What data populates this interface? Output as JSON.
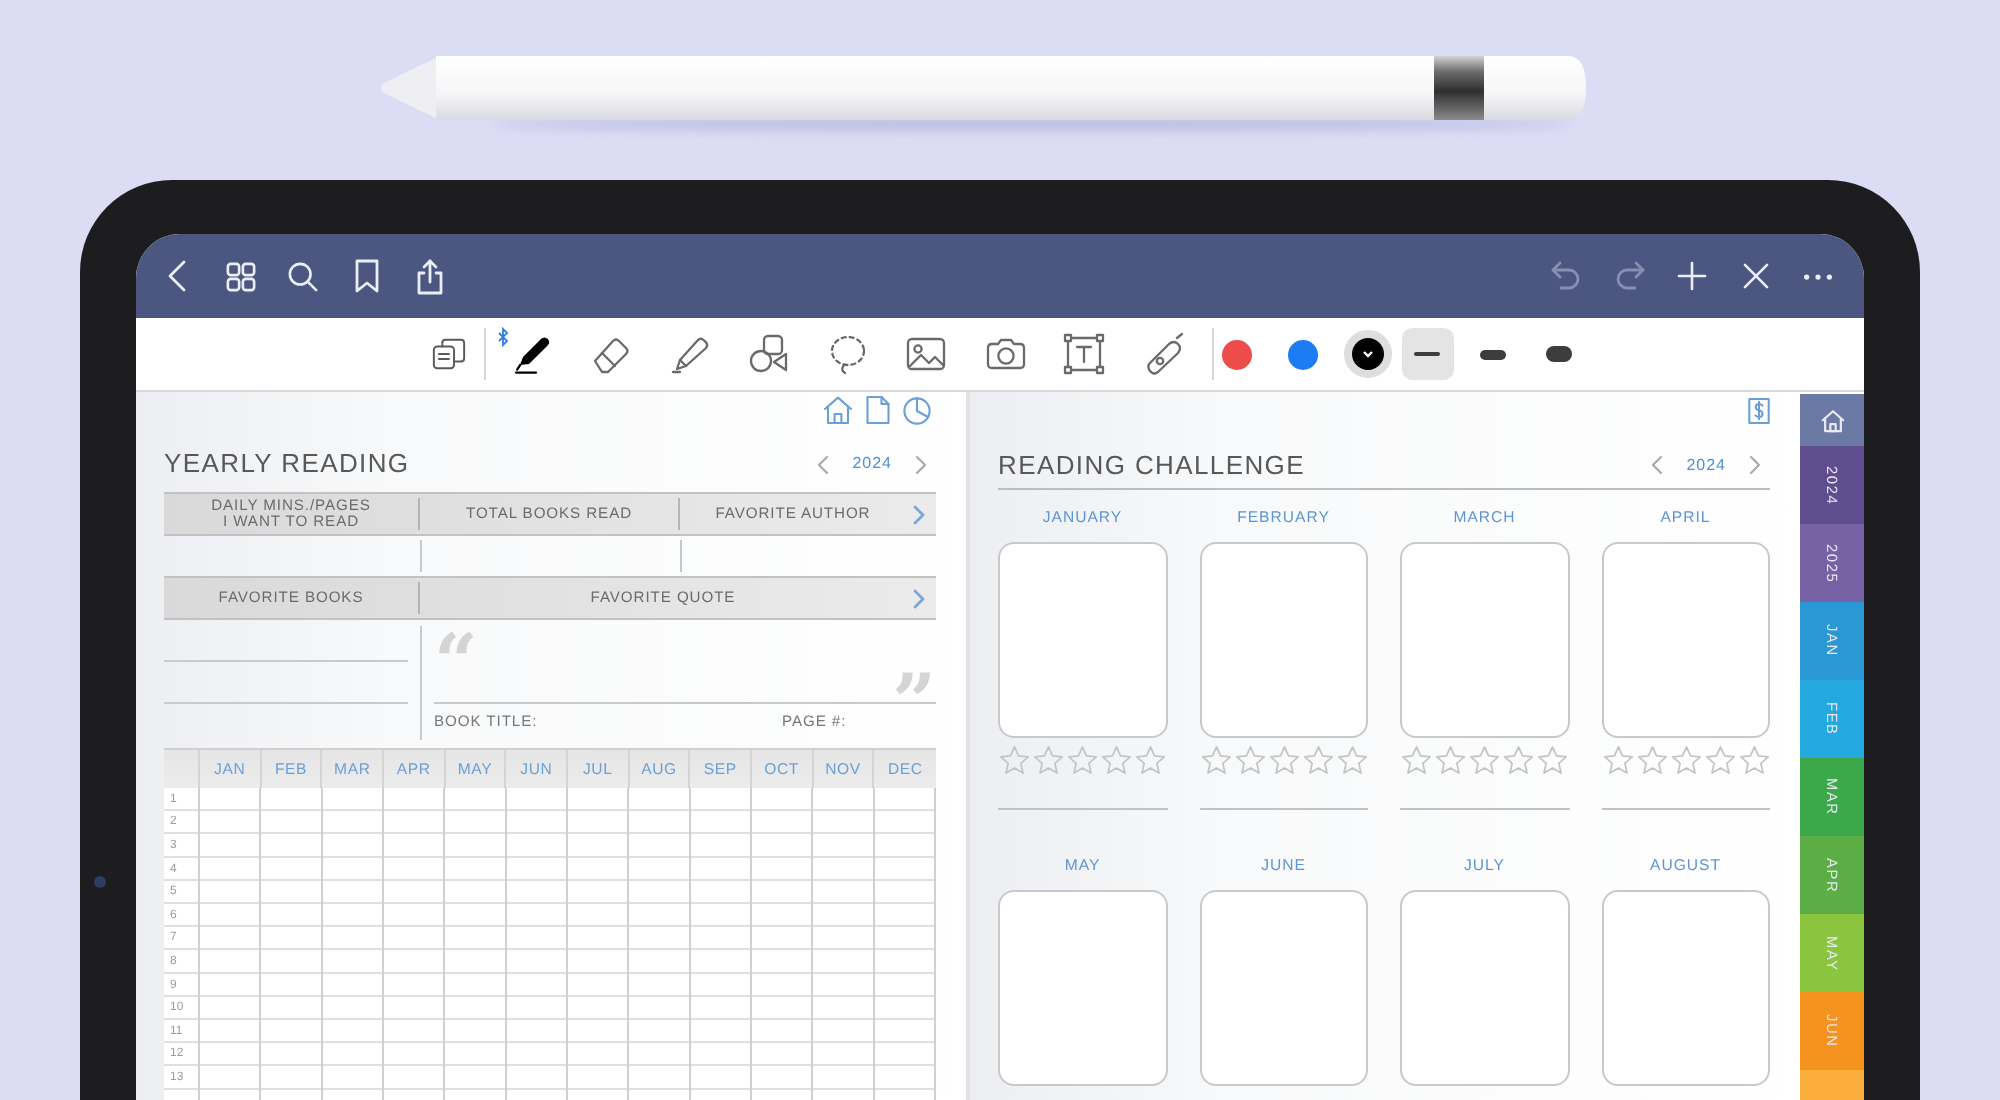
{
  "top_bar": {
    "left_buttons": [
      {
        "kind": "back"
      },
      {
        "kind": "grid"
      },
      {
        "kind": "search"
      },
      {
        "kind": "bookmark"
      },
      {
        "kind": "share"
      }
    ],
    "right_buttons": [
      {
        "kind": "undo",
        "disabled": true
      },
      {
        "kind": "redo",
        "disabled": true
      },
      {
        "kind": "add",
        "disabled": false
      },
      {
        "kind": "close",
        "disabled": false
      },
      {
        "kind": "more",
        "disabled": false
      }
    ]
  },
  "toolbar": {
    "tools": [
      {
        "kind": "pen",
        "selected": true
      },
      {
        "kind": "eraser",
        "selected": false
      },
      {
        "kind": "highlighter",
        "selected": false
      },
      {
        "kind": "shapes",
        "selected": false
      },
      {
        "kind": "lasso",
        "selected": false
      },
      {
        "kind": "image",
        "selected": false
      },
      {
        "kind": "camera",
        "selected": false
      },
      {
        "kind": "text",
        "selected": false
      },
      {
        "kind": "tape",
        "selected": false
      }
    ],
    "colors": [
      {
        "color": "#ee4b4b",
        "selected": false
      },
      {
        "color": "#1b7cf3",
        "selected": false
      },
      {
        "color": "#000000",
        "selected": true
      }
    ],
    "widths": [
      {
        "kind": "thin",
        "selected": true
      },
      {
        "kind": "medium",
        "selected": false
      },
      {
        "kind": "thick",
        "selected": false
      }
    ]
  },
  "left_page": {
    "title": "YEARLY READING",
    "year": "2024",
    "summary_headers": [
      "DAILY MINS./PAGES\nI WANT TO READ",
      "TOTAL BOOKS READ",
      "FAVORITE AUTHOR"
    ],
    "books_header": "FAVORITE BOOKS",
    "quote_header": "FAVORITE QUOTE",
    "quote_marks": [
      "“",
      "”"
    ],
    "book_title_label": "BOOK TITLE:",
    "page_label": "PAGE #:",
    "log": {
      "months": [
        "JAN",
        "FEB",
        "MAR",
        "APR",
        "MAY",
        "JUN",
        "JUL",
        "AUG",
        "SEP",
        "OCT",
        "NOV",
        "DEC"
      ],
      "rows": [
        "1",
        "2",
        "3",
        "4",
        "5",
        "6",
        "7",
        "8",
        "9",
        "10",
        "11",
        "12",
        "13"
      ]
    }
  },
  "right_page": {
    "title": "READING CHALLENGE",
    "year": "2024",
    "months": [
      {
        "name": "JANUARY",
        "stars": 0
      },
      {
        "name": "FEBRUARY",
        "stars": 0
      },
      {
        "name": "MARCH",
        "stars": 0
      },
      {
        "name": "APRIL",
        "stars": 0
      },
      {
        "name": "MAY"
      },
      {
        "name": "JUNE"
      },
      {
        "name": "JULY"
      },
      {
        "name": "AUGUST"
      }
    ]
  },
  "side_tabs": [
    {
      "kind": "home",
      "color": "#6b79a5"
    },
    {
      "kind": "label",
      "label": "2024",
      "color": "#5f4e8f"
    },
    {
      "kind": "label",
      "label": "2025",
      "color": "#7762a6"
    },
    {
      "kind": "label",
      "label": "JAN",
      "color": "#2b98d6"
    },
    {
      "kind": "label",
      "label": "FEB",
      "color": "#23a8df"
    },
    {
      "kind": "label",
      "label": "MAR",
      "color": "#3ba84a"
    },
    {
      "kind": "label",
      "label": "APR",
      "color": "#5aae45"
    },
    {
      "kind": "label",
      "label": "MAY",
      "color": "#8bc540"
    },
    {
      "kind": "label",
      "label": "JUN",
      "color": "#f6921e"
    },
    {
      "kind": "label",
      "color": "#fbae3c"
    }
  ]
}
